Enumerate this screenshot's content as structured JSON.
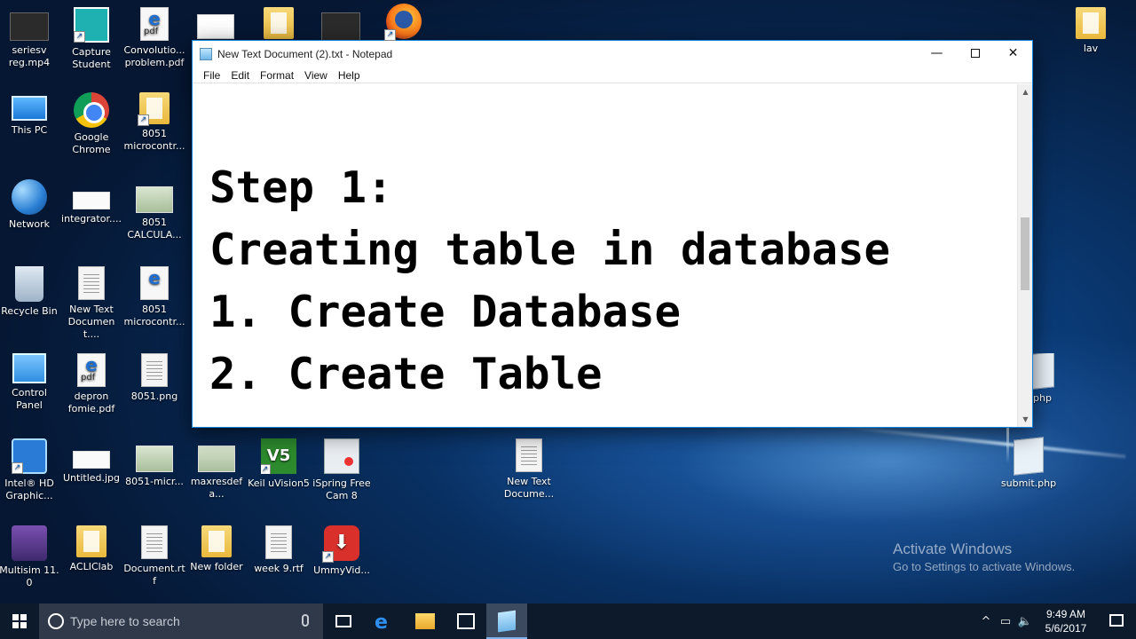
{
  "desktop": {
    "icons": [
      {
        "label": "seriesv\nreg.mp4"
      },
      {
        "label": "Capture\nStudent"
      },
      {
        "label": "Convolutio...\nproblem.pdf"
      },
      {
        "label": "This PC"
      },
      {
        "label": "Google\nChrome"
      },
      {
        "label": "8051\nmicrocontr..."
      },
      {
        "label": "Network"
      },
      {
        "label": "integrator...."
      },
      {
        "label": "8051\nCALCULA..."
      },
      {
        "label": "Recycle Bin"
      },
      {
        "label": "New Text\nDocument...."
      },
      {
        "label": "8051\nmicrocontr..."
      },
      {
        "label": "Control\nPanel"
      },
      {
        "label": "depron\nfomie.pdf"
      },
      {
        "label": "8051.png"
      },
      {
        "label": "Intel® HD\nGraphic..."
      },
      {
        "label": "Untitled.jpg"
      },
      {
        "label": "8051-micr..."
      },
      {
        "label": "maxresdefa..."
      },
      {
        "label": "Keil uVision5"
      },
      {
        "label": "iSpring Free\nCam 8"
      },
      {
        "label": "Multisim 11.0"
      },
      {
        "label": "ACLIClab"
      },
      {
        "label": "Document.rtf"
      },
      {
        "label": "New folder"
      },
      {
        "label": "week 9.rtf"
      },
      {
        "label": "UmmyVid..."
      },
      {
        "label": "New Text\nDocume..."
      },
      {
        "label": "lav"
      },
      {
        "label": "php"
      },
      {
        "label": "submit.php"
      }
    ],
    "pdf_badge": "pdf",
    "pdf_letter": "e",
    "keil_badge": "V5"
  },
  "notepad": {
    "title": "New Text Document (2).txt - Notepad",
    "controls": {
      "minimize": "—",
      "close": "✕"
    },
    "menu": [
      "File",
      "Edit",
      "Format",
      "View",
      "Help"
    ],
    "lines": [
      "Step 1:",
      "Creating table in database",
      "1. Create Database",
      "2. Create Table"
    ],
    "scroll_up": "▲",
    "scroll_down": "▼"
  },
  "watermark": {
    "title": "Activate Windows",
    "subtitle": "Go to Settings to activate Windows."
  },
  "taskbar": {
    "search_placeholder": "Type here to search",
    "edge_glyph": "e",
    "tray": {
      "chevron": "^",
      "network": "▭",
      "volume": "🔈",
      "time": "9:49 AM",
      "date": "5/6/2017"
    }
  },
  "colors": {
    "window_border": "#1883d7",
    "taskbar": "#0c1a2c",
    "desktop_bg": "#0a3a75"
  }
}
